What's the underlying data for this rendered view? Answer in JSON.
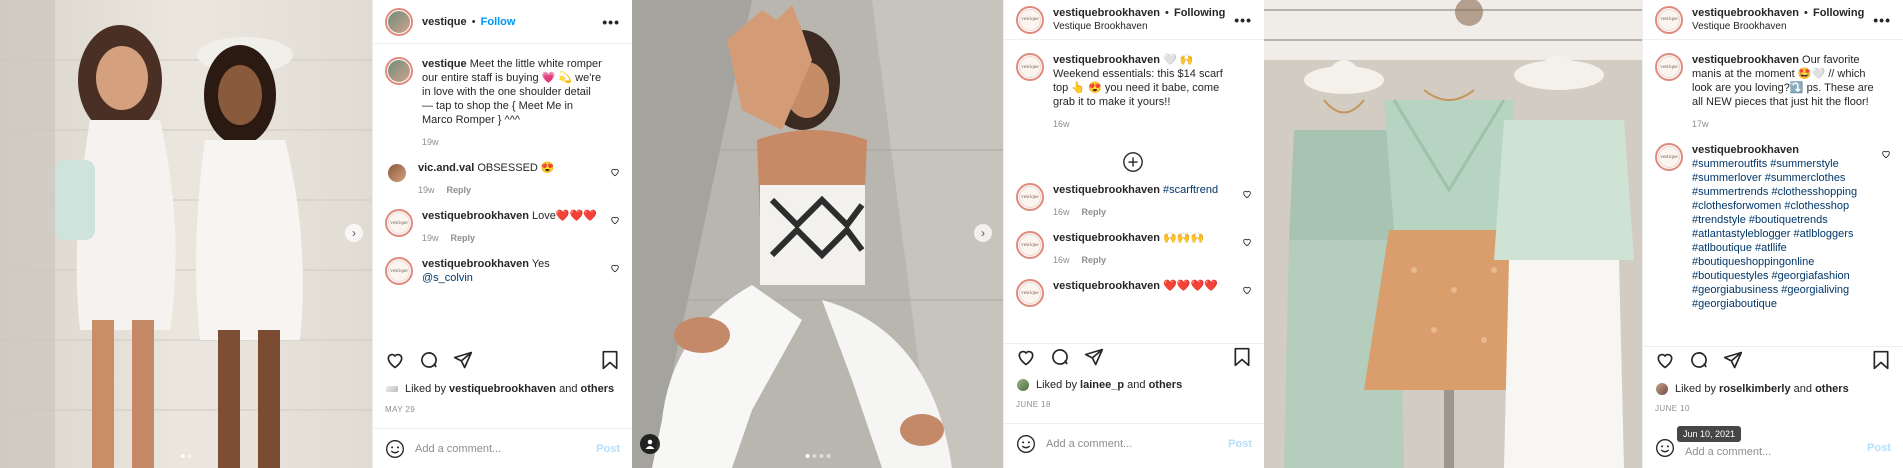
{
  "post1": {
    "header": {
      "username": "vestique",
      "separator": "•",
      "follow_label": "Follow"
    },
    "caption": {
      "username": "vestique",
      "text": "Meet the little white romper our entire staff is buying 💗 💫 we're in love with the one shoulder detail — tap to shop the { Meet Me in Marco Romper } ^^^",
      "age": "19w"
    },
    "comments": [
      {
        "username": "vic.and.val",
        "text": "OBSESSED 😍",
        "age": "19w",
        "reply": "Reply"
      },
      {
        "username": "vestiquebrookhaven",
        "text": "Love❤️❤️❤️",
        "age": "19w",
        "reply": "Reply"
      },
      {
        "username": "vestiquebrookhaven",
        "text": "Yes",
        "mention": "@s_colvin"
      }
    ],
    "liked": {
      "prefix": "Liked by",
      "user": "vestiquebrookhaven",
      "and": "and",
      "others": "others"
    },
    "date": "MAY 29",
    "add_comment_placeholder": "Add a comment...",
    "post_label": "Post"
  },
  "post2": {
    "header": {
      "username": "vestiquebrookhaven",
      "separator": "•",
      "following_label": "Following",
      "location": "Vestique Brookhaven"
    },
    "caption": {
      "username": "vestiquebrookhaven",
      "text": "🤍 🙌 Weekend essentials: this $14 scarf top 👆 😍 you need it babe, come grab it to make it yours!!",
      "age": "16w"
    },
    "comments": [
      {
        "username": "vestiquebrookhaven",
        "hashtag": "#scarftrend",
        "age": "16w",
        "reply": "Reply"
      },
      {
        "username": "vestiquebrookhaven",
        "text": "🙌🙌🙌",
        "age": "16w",
        "reply": "Reply"
      },
      {
        "username": "vestiquebrookhaven",
        "text": "❤️❤️❤️❤️"
      }
    ],
    "liked": {
      "prefix": "Liked by",
      "user": "lainee_p",
      "and": "and",
      "others": "others"
    },
    "date": "JUNE 18",
    "add_comment_placeholder": "Add a comment...",
    "post_label": "Post"
  },
  "post3": {
    "header": {
      "username": "vestiquebrookhaven",
      "separator": "•",
      "following_label": "Following",
      "location": "Vestique Brookhaven"
    },
    "caption": {
      "username": "vestiquebrookhaven",
      "text": "Our favorite manis at the moment 🤩🤍 // which look are you loving?⤵️ ps. These are all NEW pieces that just hit the floor!",
      "age": "17w"
    },
    "hashtag_comment": {
      "username": "vestiquebrookhaven",
      "tags": "#summeroutfits #summerstyle #summerlover #summerclothes #summertrends #clothesshopping #clothesforwomen #clothesshop #trendstyle #boutiquetrends #atlantastyleblogger #atlbloggers #atlboutique #atllife #boutiqueshoppingonline #boutiquestyles #georgiafashion #georgiabusiness #georgialiving #georgiaboutique"
    },
    "liked": {
      "prefix": "Liked by",
      "user": "roselkimberly",
      "and": "and",
      "others": "others"
    },
    "date": "JUNE 10",
    "tooltip": "Jun 10, 2021",
    "add_comment_placeholder": "Add a comment...",
    "post_label": "Post"
  },
  "avatar_text": "vestique",
  "icons": [
    "heart-icon",
    "comment-icon",
    "share-icon",
    "bookmark-icon",
    "emoji-icon",
    "more-icon",
    "chevron-right-icon",
    "plus-circle-icon",
    "user-tag-icon"
  ],
  "colors": {
    "link_blue": "#0095f6",
    "hashtag": "#00376b",
    "muted": "#8e8e8e",
    "heart_red": "#ed4956"
  }
}
